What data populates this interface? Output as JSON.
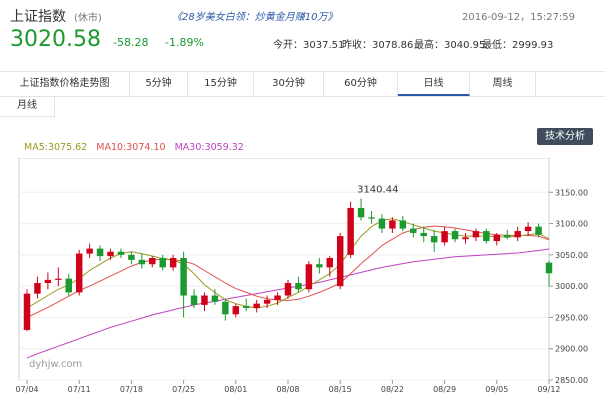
{
  "header": {
    "index_name": "上证指数",
    "status": "(休市)",
    "promo_link": "《28岁美女白领：炒黄金月赚10万》",
    "timestamp": "2016-09-12，15:27:59",
    "current_price": "3020.58",
    "change": "-58.28",
    "change_pct": "-1.89%",
    "open_label": "今开：3037.51",
    "prev_close_label": "昨收：3078.86",
    "high_label": "最高：3040.95",
    "low_label": "最低：2999.93",
    "colors": {
      "down": "#1a9a2f",
      "up": "#d0021b",
      "link": "#2b5aa8"
    }
  },
  "tabs": [
    {
      "label": "上证指数价格走势图",
      "active": false
    },
    {
      "label": "5分钟",
      "active": false
    },
    {
      "label": "15分钟",
      "active": false
    },
    {
      "label": "30分钟",
      "active": false
    },
    {
      "label": "60分钟",
      "active": false
    },
    {
      "label": "日线",
      "active": true
    },
    {
      "label": "周线",
      "active": false
    },
    {
      "label": "月线",
      "active": false
    }
  ],
  "tech_button_label": "技术分析",
  "ma_legend": [
    {
      "label": "MA5:3075.62",
      "color": "#9a9a20"
    },
    {
      "label": "MA10:3074.10",
      "color": "#e05050"
    },
    {
      "label": "MA30:3059.32",
      "color": "#c040c0"
    }
  ],
  "watermark": "dyhjw.com",
  "chart_data": {
    "type": "candlestick",
    "peak_label": "3140.44",
    "ylim": [
      2850,
      3200
    ],
    "y_ticks": [
      "3150.00",
      "3100.00",
      "3050.00",
      "3000.00",
      "2950.00",
      "2900.00",
      "2850.00"
    ],
    "y_tick_values": [
      3150,
      3100,
      3050,
      3000,
      2950,
      2900,
      2850
    ],
    "x_labels": [
      "07/04",
      "07/11",
      "07/18",
      "07/25",
      "08/01",
      "08/08",
      "08/15",
      "08/22",
      "08/29",
      "09/05",
      "09/12"
    ],
    "x_label_index": [
      0,
      5,
      10,
      15,
      20,
      25,
      30,
      35,
      40,
      45,
      50
    ],
    "candles": [
      {
        "o": 2930,
        "h": 2995,
        "l": 2928,
        "c": 2988
      },
      {
        "o": 2988,
        "h": 3015,
        "l": 2980,
        "c": 3005
      },
      {
        "o": 3005,
        "h": 3022,
        "l": 2995,
        "c": 3010
      },
      {
        "o": 3010,
        "h": 3030,
        "l": 3000,
        "c": 3012
      },
      {
        "o": 3012,
        "h": 3020,
        "l": 2985,
        "c": 2990
      },
      {
        "o": 2990,
        "h": 3058,
        "l": 2985,
        "c": 3052
      },
      {
        "o": 3052,
        "h": 3068,
        "l": 3045,
        "c": 3060
      },
      {
        "o": 3060,
        "h": 3065,
        "l": 3040,
        "c": 3048
      },
      {
        "o": 3048,
        "h": 3060,
        "l": 3042,
        "c": 3055
      },
      {
        "o": 3055,
        "h": 3060,
        "l": 3045,
        "c": 3050
      },
      {
        "o": 3050,
        "h": 3055,
        "l": 3035,
        "c": 3042
      },
      {
        "o": 3042,
        "h": 3052,
        "l": 3028,
        "c": 3035
      },
      {
        "o": 3035,
        "h": 3048,
        "l": 3030,
        "c": 3045
      },
      {
        "o": 3045,
        "h": 3050,
        "l": 3025,
        "c": 3030
      },
      {
        "o": 3030,
        "h": 3050,
        "l": 3025,
        "c": 3045
      },
      {
        "o": 3045,
        "h": 3055,
        "l": 2950,
        "c": 2985
      },
      {
        "o": 2985,
        "h": 2995,
        "l": 2965,
        "c": 2970
      },
      {
        "o": 2970,
        "h": 2990,
        "l": 2960,
        "c": 2985
      },
      {
        "o": 2985,
        "h": 2995,
        "l": 2970,
        "c": 2975
      },
      {
        "o": 2975,
        "h": 2980,
        "l": 2945,
        "c": 2955
      },
      {
        "o": 2955,
        "h": 2972,
        "l": 2950,
        "c": 2968
      },
      {
        "o": 2968,
        "h": 2980,
        "l": 2960,
        "c": 2965
      },
      {
        "o": 2965,
        "h": 2978,
        "l": 2958,
        "c": 2972
      },
      {
        "o": 2972,
        "h": 2985,
        "l": 2965,
        "c": 2978
      },
      {
        "o": 2978,
        "h": 2990,
        "l": 2970,
        "c": 2985
      },
      {
        "o": 2985,
        "h": 3010,
        "l": 2980,
        "c": 3005
      },
      {
        "o": 3005,
        "h": 3015,
        "l": 2990,
        "c": 2995
      },
      {
        "o": 2995,
        "h": 3040,
        "l": 2990,
        "c": 3035
      },
      {
        "o": 3035,
        "h": 3045,
        "l": 3020,
        "c": 3030
      },
      {
        "o": 3030,
        "h": 3048,
        "l": 3015,
        "c": 3045
      },
      {
        "o": 3000,
        "h": 3085,
        "l": 2995,
        "c": 3080
      },
      {
        "o": 3050,
        "h": 3135,
        "l": 3045,
        "c": 3125
      },
      {
        "o": 3125,
        "h": 3140,
        "l": 3105,
        "c": 3110
      },
      {
        "o": 3110,
        "h": 3120,
        "l": 3100,
        "c": 3108
      },
      {
        "o": 3108,
        "h": 3115,
        "l": 3085,
        "c": 3092
      },
      {
        "o": 3092,
        "h": 3110,
        "l": 3085,
        "c": 3105
      },
      {
        "o": 3105,
        "h": 3112,
        "l": 3088,
        "c": 3092
      },
      {
        "o": 3092,
        "h": 3100,
        "l": 3078,
        "c": 3085
      },
      {
        "o": 3085,
        "h": 3095,
        "l": 3070,
        "c": 3080
      },
      {
        "o": 3080,
        "h": 3090,
        "l": 3055,
        "c": 3070
      },
      {
        "o": 3070,
        "h": 3095,
        "l": 3065,
        "c": 3088
      },
      {
        "o": 3088,
        "h": 3092,
        "l": 3070,
        "c": 3075
      },
      {
        "o": 3075,
        "h": 3085,
        "l": 3068,
        "c": 3078
      },
      {
        "o": 3078,
        "h": 3092,
        "l": 3072,
        "c": 3088
      },
      {
        "o": 3088,
        "h": 3092,
        "l": 3068,
        "c": 3072
      },
      {
        "o": 3072,
        "h": 3085,
        "l": 3065,
        "c": 3082
      },
      {
        "o": 3082,
        "h": 3090,
        "l": 3075,
        "c": 3078
      },
      {
        "o": 3078,
        "h": 3095,
        "l": 3072,
        "c": 3088
      },
      {
        "o": 3088,
        "h": 3102,
        "l": 3080,
        "c": 3095
      },
      {
        "o": 3095,
        "h": 3100,
        "l": 3078,
        "c": 3082
      },
      {
        "o": 3037.51,
        "h": 3040.95,
        "l": 2999.93,
        "c": 3020.58
      }
    ],
    "ma5": [
      2965,
      2975,
      2985,
      2995,
      3002,
      3012,
      3025,
      3035,
      3045,
      3052,
      3055,
      3052,
      3048,
      3044,
      3042,
      3035,
      3020,
      3002,
      2990,
      2978,
      2972,
      2968,
      2965,
      2968,
      2973,
      2982,
      2990,
      3000,
      3010,
      3020,
      3035,
      3058,
      3080,
      3095,
      3105,
      3108,
      3103,
      3098,
      3093,
      3088,
      3085,
      3082,
      3080,
      3080,
      3080,
      3079,
      3078,
      3080,
      3082,
      3084,
      3075.62
    ],
    "ma10": [
      2950,
      2958,
      2966,
      2975,
      2984,
      2993,
      3000,
      3008,
      3016,
      3024,
      3032,
      3038,
      3042,
      3043,
      3042,
      3040,
      3035,
      3025,
      3015,
      3005,
      2996,
      2990,
      2984,
      2980,
      2978,
      2977,
      2979,
      2984,
      2990,
      2997,
      3005,
      3020,
      3036,
      3050,
      3065,
      3075,
      3085,
      3090,
      3094,
      3096,
      3095,
      3093,
      3090,
      3087,
      3084,
      3082,
      3081,
      3081,
      3081,
      3080,
      3074.1
    ],
    "ma30": [
      2885,
      2892,
      2898,
      2904,
      2910,
      2916,
      2922,
      2928,
      2934,
      2939,
      2944,
      2949,
      2954,
      2958,
      2962,
      2966,
      2970,
      2973,
      2976,
      2979,
      2982,
      2985,
      2988,
      2991,
      2994,
      2997,
      3000,
      3003,
      3006,
      3010,
      3014,
      3018,
      3022,
      3026,
      3030,
      3033,
      3036,
      3039,
      3041,
      3043,
      3045,
      3047,
      3048,
      3049,
      3050,
      3051,
      3052,
      3053,
      3055,
      3057,
      3059.32
    ]
  }
}
